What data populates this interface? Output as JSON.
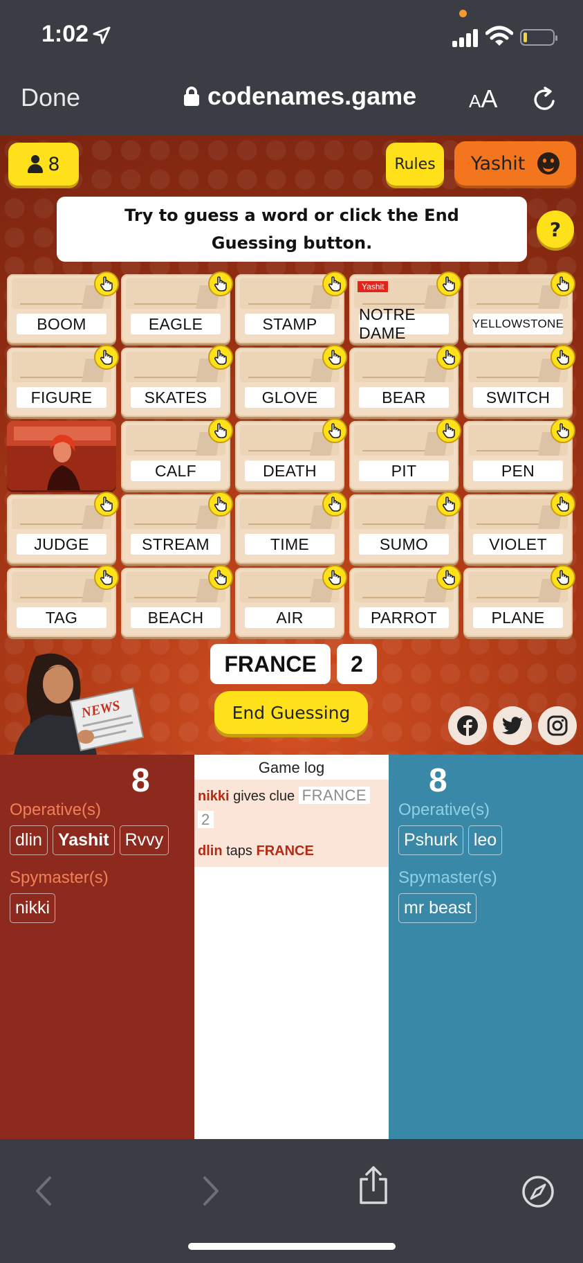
{
  "status_bar": {
    "time": "1:02"
  },
  "safari": {
    "done_label": "Done",
    "url": "codenames.game",
    "text_size_small": "A",
    "text_size_big": "A"
  },
  "header": {
    "players_count": "8",
    "rules_label": "Rules",
    "user_name": "Yashit",
    "instruction": "Try to guess a word or click the End Guessing button.",
    "help_label": "?"
  },
  "board": {
    "cards": [
      {
        "word": "BOOM",
        "tapped_by": ""
      },
      {
        "word": "EAGLE",
        "tapped_by": ""
      },
      {
        "word": "STAMP",
        "tapped_by": ""
      },
      {
        "word": "NOTRE DAME",
        "tapped_by": "Yashit"
      },
      {
        "word": "YELLOWSTONE",
        "tapped_by": ""
      },
      {
        "word": "FIGURE",
        "tapped_by": ""
      },
      {
        "word": "SKATES",
        "tapped_by": ""
      },
      {
        "word": "GLOVE",
        "tapped_by": ""
      },
      {
        "word": "BEAR",
        "tapped_by": ""
      },
      {
        "word": "SWITCH",
        "tapped_by": ""
      },
      {
        "word": "",
        "revealed": "red-agent"
      },
      {
        "word": "CALF",
        "tapped_by": ""
      },
      {
        "word": "DEATH",
        "tapped_by": ""
      },
      {
        "word": "PIT",
        "tapped_by": ""
      },
      {
        "word": "PEN",
        "tapped_by": ""
      },
      {
        "word": "JUDGE",
        "tapped_by": ""
      },
      {
        "word": "STREAM",
        "tapped_by": ""
      },
      {
        "word": "TIME",
        "tapped_by": ""
      },
      {
        "word": "SUMO",
        "tapped_by": ""
      },
      {
        "word": "VIOLET",
        "tapped_by": ""
      },
      {
        "word": "TAG",
        "tapped_by": ""
      },
      {
        "word": "BEACH",
        "tapped_by": ""
      },
      {
        "word": "AIR",
        "tapped_by": ""
      },
      {
        "word": "PARROT",
        "tapped_by": ""
      },
      {
        "word": "PLANE",
        "tapped_by": ""
      }
    ]
  },
  "clue": {
    "word": "FRANCE",
    "number": "2"
  },
  "end_guessing_label": "End Guessing",
  "spymaster_art": {
    "newspaper_text": "NEWS"
  },
  "social": [
    "facebook-icon",
    "twitter-icon",
    "instagram-icon"
  ],
  "red_team": {
    "remaining": "8",
    "operatives_label": "Operative(s)",
    "operatives": [
      "dlin",
      "Yashit",
      "Rvvy"
    ],
    "spymasters_label": "Spymaster(s)",
    "spymasters": [
      "nikki"
    ]
  },
  "game_log": {
    "title": "Game log",
    "entry1": {
      "player": "nikki",
      "action": "gives clue",
      "clue": "FRANCE",
      "number": "2"
    },
    "entry2": {
      "player": "dlin",
      "action": "taps",
      "target": "FRANCE"
    }
  },
  "blue_team": {
    "remaining": "8",
    "operatives_label": "Operative(s)",
    "operatives": [
      "Pshurk",
      "leo"
    ],
    "spymasters_label": "Spymaster(s)",
    "spymasters": [
      "mr beast"
    ]
  },
  "colors": {
    "red_team": "#8e2a1d",
    "blue_team": "#3a88a7",
    "button_yellow": "#ffe11b",
    "user_orange": "#f3761f"
  }
}
